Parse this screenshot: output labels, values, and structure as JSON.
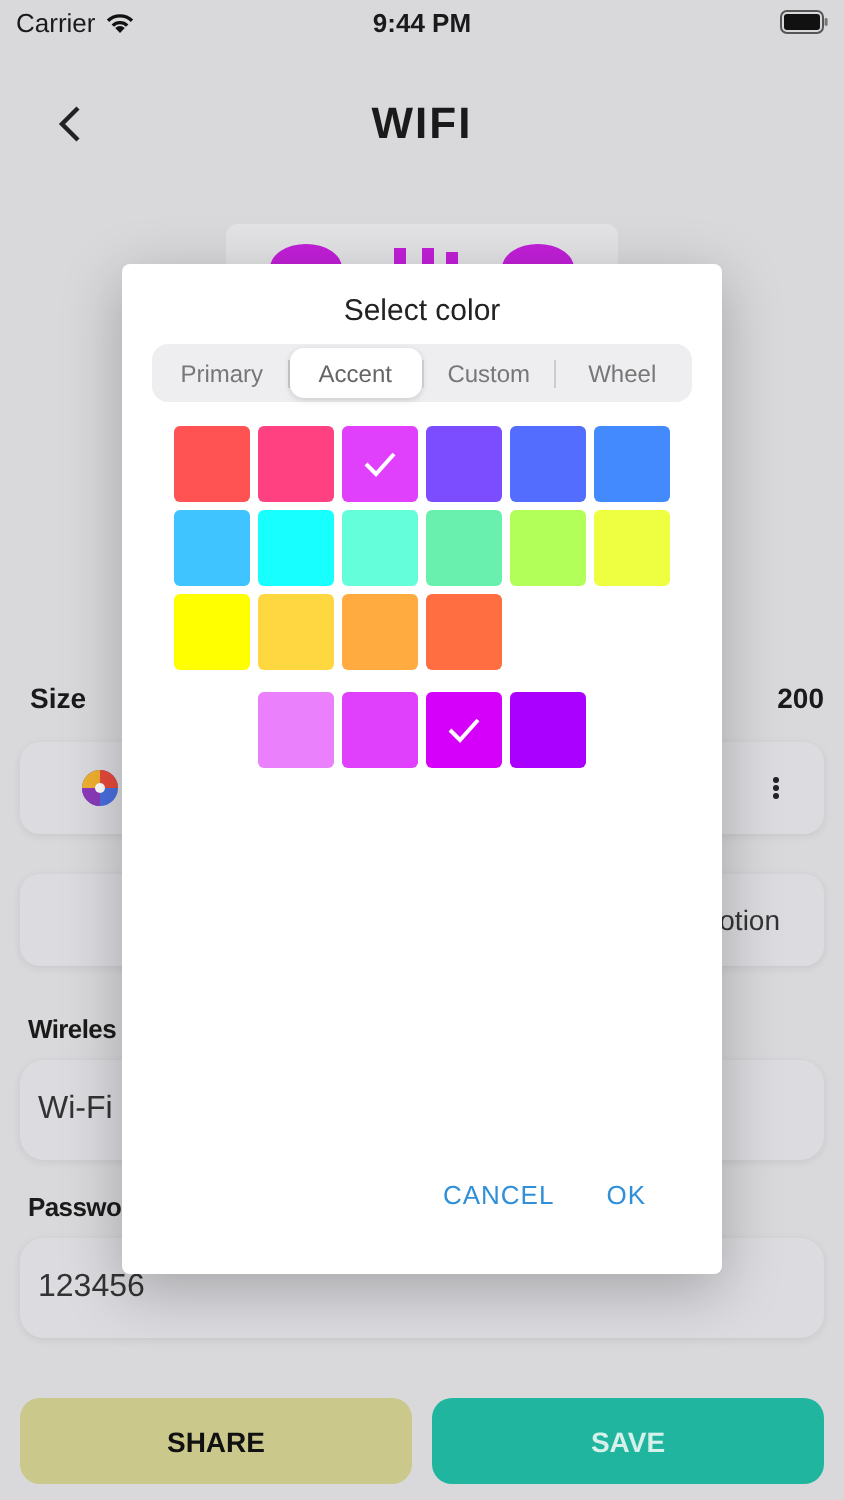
{
  "status_bar": {
    "carrier": "Carrier",
    "time": "9:44 PM"
  },
  "header": {
    "title": "WIFI"
  },
  "size": {
    "label": "Size",
    "value": "200"
  },
  "option_row": {
    "right_text": "otion"
  },
  "fields": [
    {
      "label": "Wireles",
      "value": "Wi-Fi"
    },
    {
      "label": "Passwo",
      "value": "123456"
    }
  ],
  "buttons": [
    {
      "kind": "share",
      "label": "SHARE"
    },
    {
      "kind": "save",
      "label": "SAVE"
    }
  ],
  "dialog": {
    "title": "Select color",
    "tabs": [
      {
        "label": "Primary",
        "selected": false
      },
      {
        "label": "Accent",
        "selected": true
      },
      {
        "label": "Custom",
        "selected": false
      },
      {
        "label": "Wheel",
        "selected": false
      }
    ],
    "swatch_rows": [
      [
        {
          "color": "#ff5252",
          "selected": false
        },
        {
          "color": "#ff4081",
          "selected": false
        },
        {
          "color": "#e040fb",
          "selected": true
        },
        {
          "color": "#7c4dff",
          "selected": false
        },
        {
          "color": "#536dfe",
          "selected": false
        },
        {
          "color": "#448aff",
          "selected": false
        }
      ],
      [
        {
          "color": "#40c4ff",
          "selected": false
        },
        {
          "color": "#18ffff",
          "selected": false
        },
        {
          "color": "#64ffda",
          "selected": false
        },
        {
          "color": "#69f0ae",
          "selected": false
        },
        {
          "color": "#b2ff59",
          "selected": false
        },
        {
          "color": "#eeff41",
          "selected": false
        }
      ],
      [
        {
          "color": "#ffff00",
          "selected": false
        },
        {
          "color": "#ffd740",
          "selected": false
        },
        {
          "color": "#ffab40",
          "selected": false
        },
        {
          "color": "#ff6e40",
          "selected": false
        }
      ]
    ],
    "shades": [
      {
        "color": "#ea80fc",
        "selected": false
      },
      {
        "color": "#e040fb",
        "selected": false
      },
      {
        "color": "#d500f9",
        "selected": true
      },
      {
        "color": "#aa00ff",
        "selected": false
      }
    ],
    "actions": [
      "CANCEL",
      "OK"
    ]
  }
}
